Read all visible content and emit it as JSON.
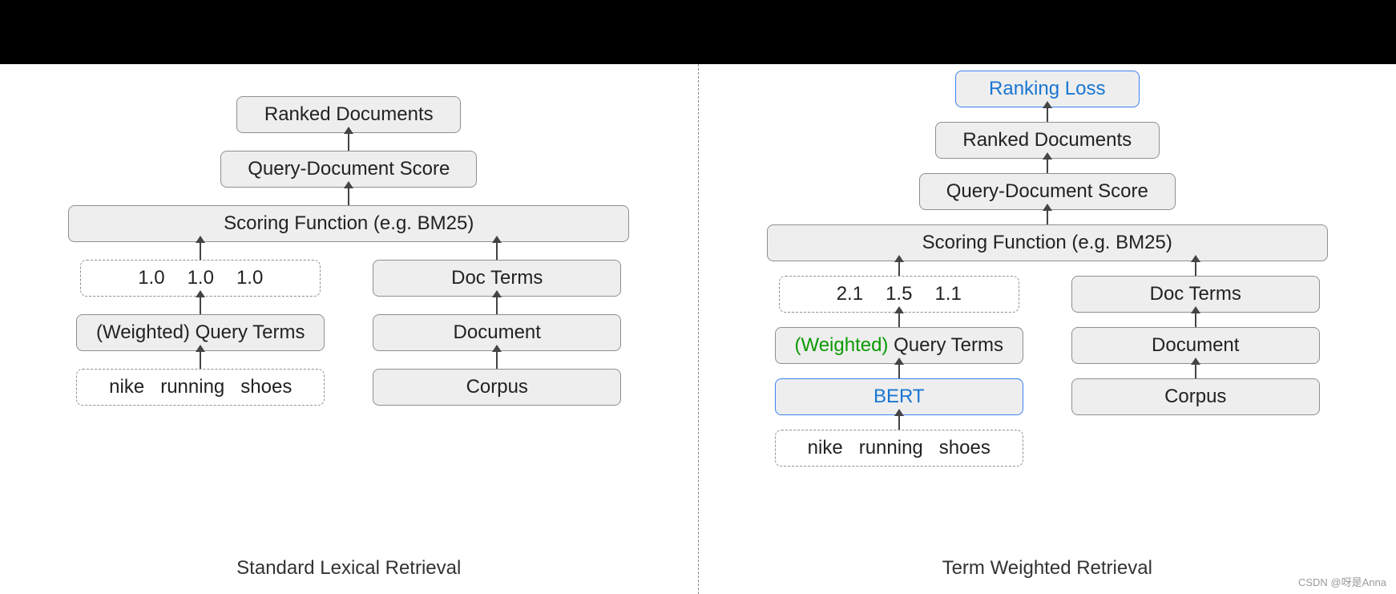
{
  "left": {
    "caption": "Standard Lexical Retrieval",
    "ranked": "Ranked Documents",
    "qds": "Query-Document Score",
    "scoring": "Scoring Function (e.g. BM25)",
    "weights": {
      "v0": "1.0",
      "v1": "1.0",
      "v2": "1.0"
    },
    "wqt_pre": "(Weighted) ",
    "wqt_post": "Query Terms",
    "query": "nike   running   shoes",
    "docterms": "Doc Terms",
    "document": "Document",
    "corpus": "Corpus"
  },
  "right": {
    "caption": "Term Weighted Retrieval",
    "loss": "Ranking Loss",
    "ranked": "Ranked Documents",
    "qds": "Query-Document Score",
    "scoring": "Scoring Function (e.g. BM25)",
    "weights": {
      "v0": "2.1",
      "v1": "1.5",
      "v2": "1.1"
    },
    "wqt_green": "(Weighted) ",
    "wqt_post": "Query Terms",
    "bert": "BERT",
    "query": "nike   running   shoes",
    "docterms": "Doc Terms",
    "document": "Document",
    "corpus": "Corpus"
  },
  "watermark": "CSDN @呀是Anna"
}
